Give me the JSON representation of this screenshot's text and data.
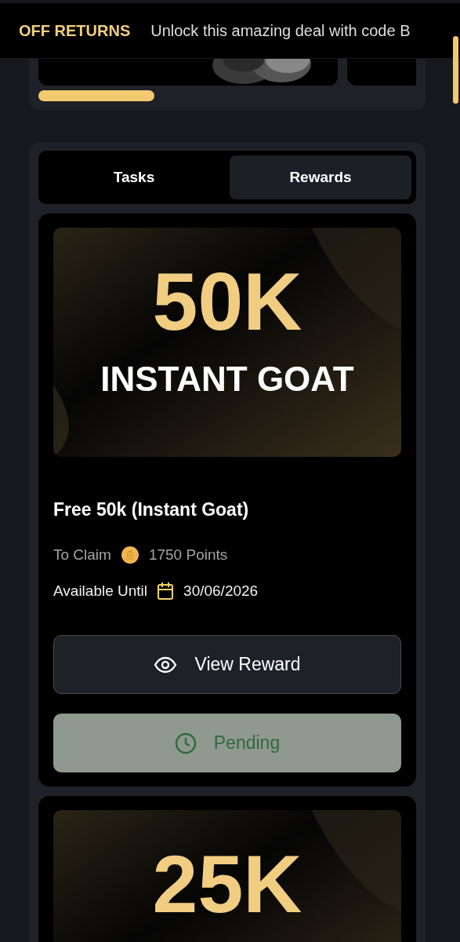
{
  "ticker": {
    "items": [
      {
        "text": "OFF RETURNS",
        "kind": "highlight"
      },
      {
        "text": "Unlock this amazing deal with code B",
        "kind": "plain"
      }
    ]
  },
  "carousel": {
    "slides": [
      {
        "kind": "picture"
      },
      {
        "kind": "blank"
      }
    ]
  },
  "tabs": [
    {
      "label": "Tasks",
      "selected": false
    },
    {
      "label": "Rewards",
      "selected": true
    }
  ],
  "rewards": [
    {
      "banner_amount": "50K",
      "banner_subtitle": "INSTANT GOAT",
      "title": "Free 50k (Instant Goat)",
      "claim_label": "To Claim",
      "points": "1750 Points",
      "until_label": "Available Until",
      "date": "30/06/2026",
      "view_label": "View Reward",
      "status": "Pending",
      "pending": true
    },
    {
      "banner_amount": "25K"
    }
  ]
}
